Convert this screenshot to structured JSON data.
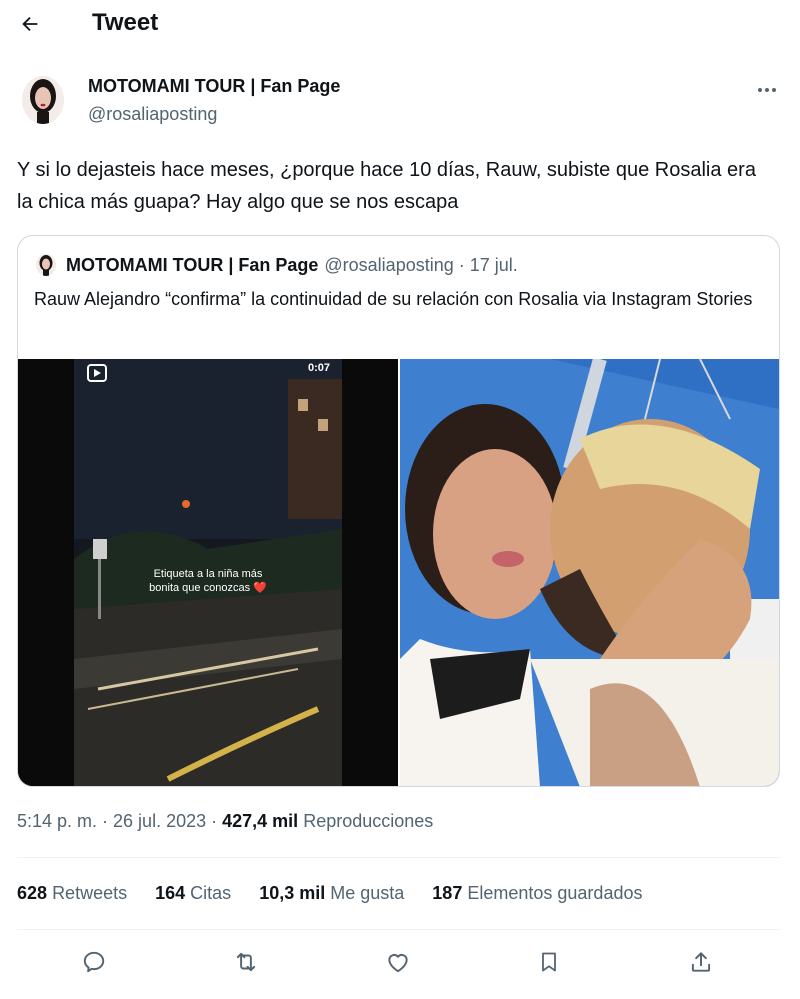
{
  "header": {
    "title": "Tweet"
  },
  "tweet": {
    "author_name": "MOTOMAMI TOUR | Fan Page",
    "author_handle": "@rosaliaposting",
    "text": "Y si lo dejasteis hace meses, ¿porque hace 10 días, Rauw, subiste que Rosalia era la chica más guapa? Hay algo que se nos escapa",
    "time": "5:14 p. m. · 26 jul. 2023 ·",
    "views_count": "427,4 mil",
    "views_label": "Reproducciones"
  },
  "quote": {
    "author_name": "MOTOMAMI TOUR | Fan Page",
    "author_handle": "@rosaliaposting",
    "dot": "·",
    "date": "17 jul.",
    "text": "Rauw Alejandro “confirma” la continuidad de su relación con Rosalia via Instagram Stories",
    "video_time": "0:07",
    "video_caption_line1": "Etiqueta a la niña más",
    "video_caption_line2": "bonita que conozcas ❤️"
  },
  "stats": [
    {
      "count": "628",
      "label": "Retweets"
    },
    {
      "count": "164",
      "label": "Citas"
    },
    {
      "count": "10,3 mil",
      "label": "Me gusta"
    },
    {
      "count": "187",
      "label": "Elementos guardados"
    }
  ],
  "actions": {
    "icons": [
      "reply-icon",
      "retweet-icon",
      "like-icon",
      "bookmark-icon",
      "share-icon"
    ]
  },
  "colors": {
    "text": "#0f1419",
    "secondary": "#536471",
    "border": "#cfd9de"
  }
}
